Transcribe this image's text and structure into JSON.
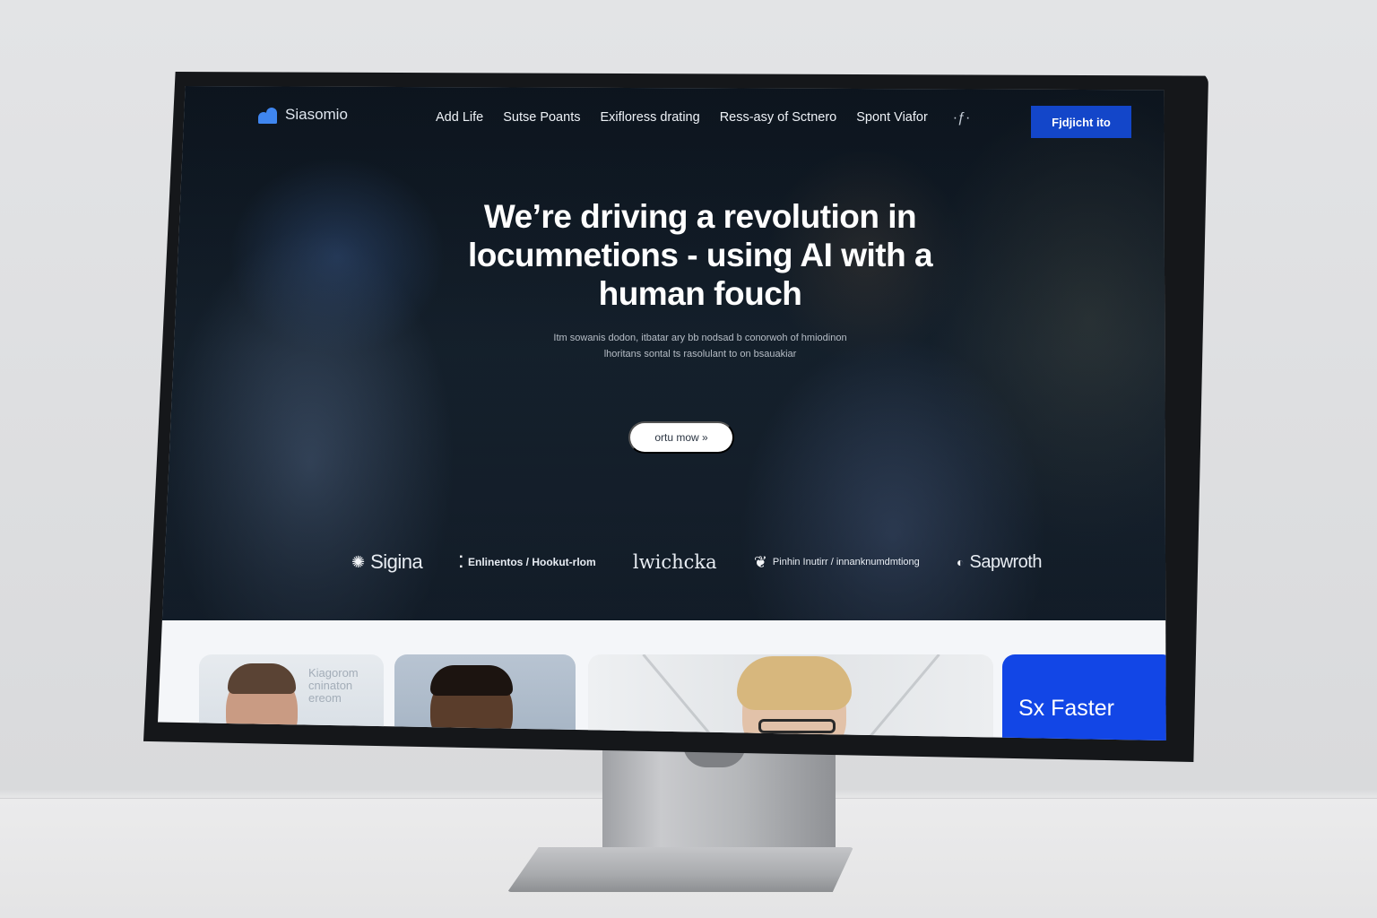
{
  "header": {
    "logo_text": "Siasomio",
    "nav": [
      "Add Life",
      "Sutse Poants",
      "Exifloress drating",
      "Ress-asy of Sctnero",
      "Spont Viafor"
    ],
    "cta_label": "Fjdjicht ito"
  },
  "hero": {
    "headline": "We’re driving a revolution in locumnetions - using AI with a human fouch",
    "subtext": "Itm sowanis dodon, itbatar ary bb nodsad b conorwoh of hmiodinon lhoritans sontal ts rasolulant to on bsauakiar",
    "button_label": "ortu mow »"
  },
  "partner_logos": [
    {
      "name": "Sigina",
      "icon": "lightbulb-icon"
    },
    {
      "name": "Enlinentos / Hookut-rlom",
      "icon": "grid-icon"
    },
    {
      "name": "lwichcka",
      "icon": ""
    },
    {
      "name": "Pinhin Inutirr / innanknumdmtiong",
      "icon": "leaf-icon"
    },
    {
      "name": "Sapwroth",
      "icon": "drop-icon"
    }
  ],
  "cards": {
    "card1_overlay": "Kiagorom cninaton ereom",
    "card4_label": "Sx Faster"
  },
  "colors": {
    "accent": "#1346c9",
    "card_blue": "#1246e6",
    "hero_bg": "#131e29"
  }
}
